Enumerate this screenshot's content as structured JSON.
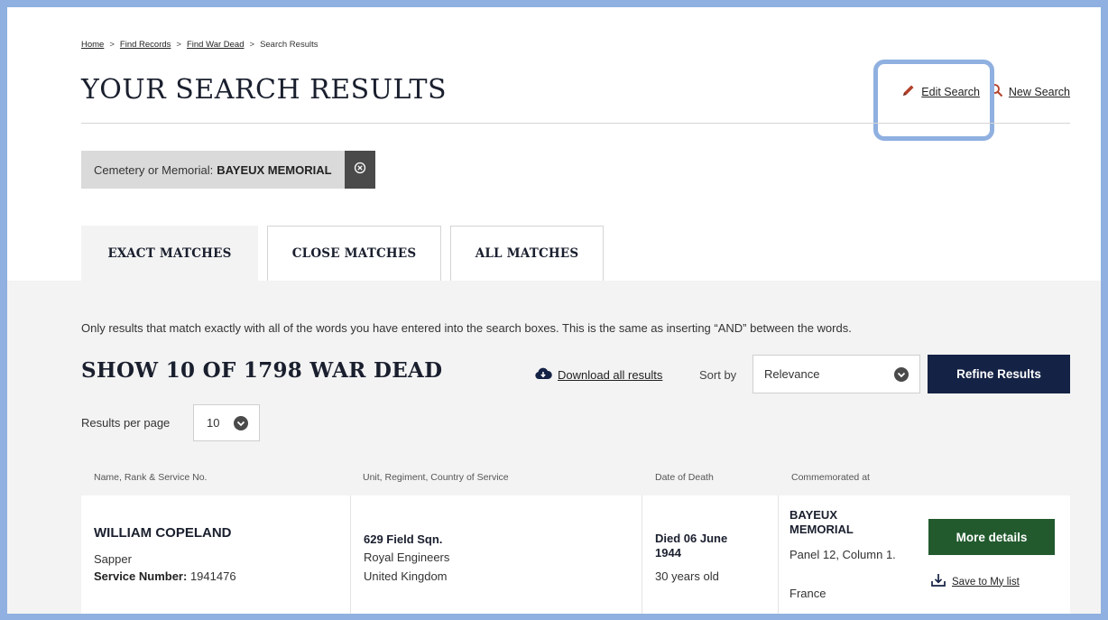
{
  "breadcrumb": [
    {
      "label": "Home",
      "link": true
    },
    {
      "label": "Find Records",
      "link": true
    },
    {
      "label": "Find War Dead",
      "link": true
    },
    {
      "label": "Search Results",
      "link": false
    }
  ],
  "breadcrumb_separator": ">",
  "page_title": "YOUR SEARCH RESULTS",
  "actions": {
    "edit_search": "Edit Search",
    "new_search": "New Search"
  },
  "filter": {
    "label": "Cemetery or Memorial:",
    "value": "BAYEUX MEMORIAL"
  },
  "tabs": [
    {
      "label": "EXACT MATCHES",
      "active": true
    },
    {
      "label": "CLOSE MATCHES",
      "active": false
    },
    {
      "label": "ALL MATCHES",
      "active": false
    }
  ],
  "intro_text": "Only results that match exactly with all of the words you have entered into the search boxes. This is the same as inserting “AND” between the words.",
  "results_heading": "SHOW 10 OF 1798 WAR DEAD",
  "download_label": "Download all results",
  "sort": {
    "label": "Sort by",
    "value": "Relevance"
  },
  "refine_label": "Refine Results",
  "results_per_page": {
    "label": "Results per page",
    "value": "10"
  },
  "columns": [
    "Name, Rank & Service No.",
    "Unit, Regiment, Country of Service",
    "Date of Death",
    "Commemorated at"
  ],
  "rows": [
    {
      "name": "WILLIAM COPELAND",
      "rank": "Sapper",
      "service_label": "Service Number:",
      "service_number": "1941476",
      "unit": "629 Field Sqn.",
      "regiment": "Royal Engineers",
      "country": "United Kingdom",
      "date_of_death": "Died 06 June 1944",
      "age": "30 years old",
      "memorial": "BAYEUX MEMORIAL",
      "panel": "Panel 12, Column 1.",
      "memorial_country": "France",
      "more_details": "More details",
      "save_label": "Save to My list"
    }
  ],
  "colors": {
    "navy": "#142245",
    "green": "#225a2e",
    "highlight": "#8fb0e0",
    "pencil": "#b3412a"
  }
}
